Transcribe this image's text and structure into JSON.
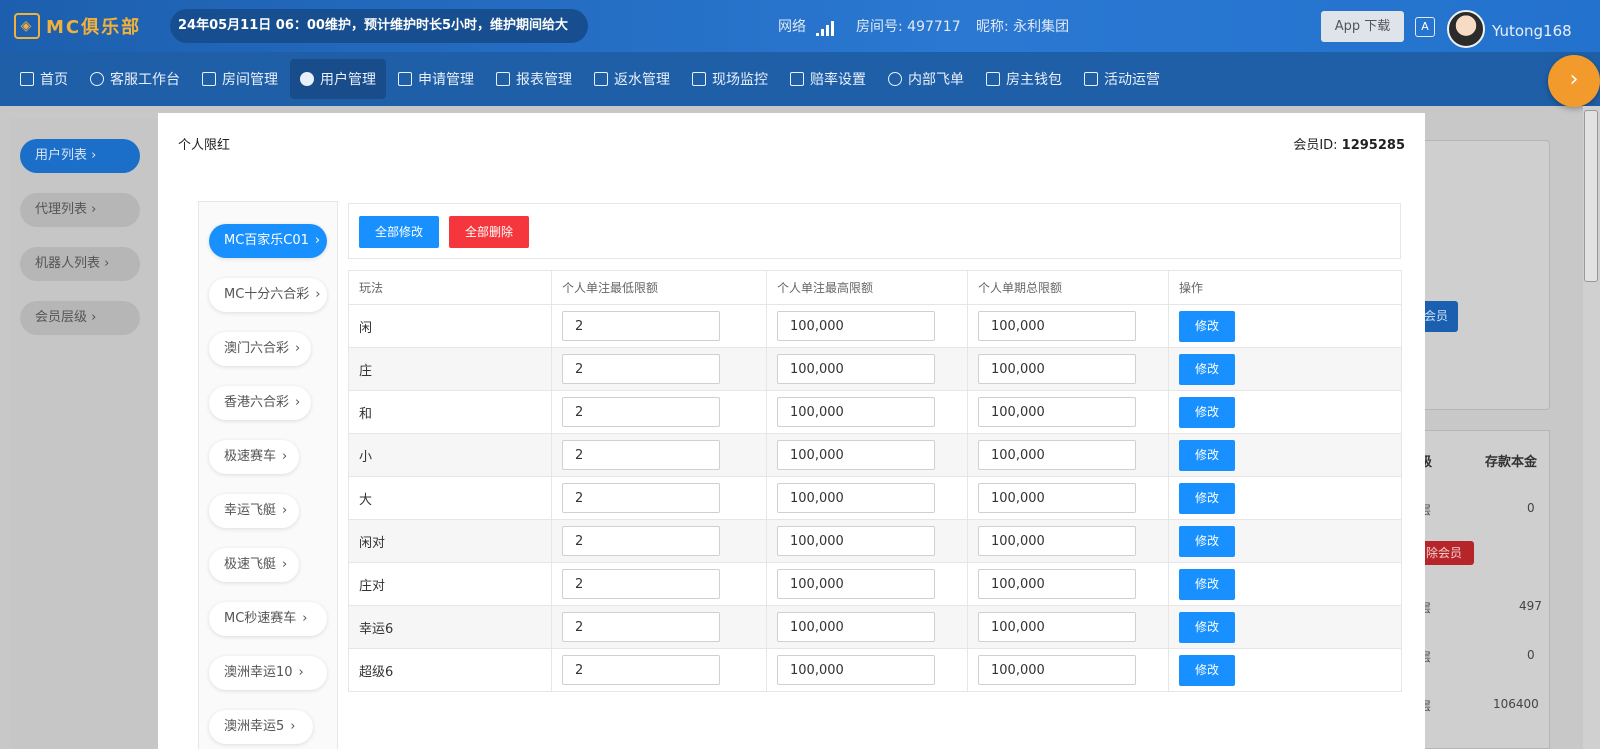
{
  "header": {
    "logo_text": "MC俱乐部",
    "notice": "24年05月11日 06：00维护，预计维护时长5小时，维护期间给大",
    "network_label": "网络",
    "room_label": "房间号: 497717",
    "nickname_label": "昵称: 永利集团",
    "app_download": "App 下载",
    "username": "Yutong168"
  },
  "nav": [
    {
      "label": "首页",
      "icon": "home-icon"
    },
    {
      "label": "客服工作台",
      "icon": "headset-icon"
    },
    {
      "label": "房间管理",
      "icon": "grid-icon"
    },
    {
      "label": "用户管理",
      "icon": "user-icon",
      "active": true
    },
    {
      "label": "申请管理",
      "icon": "document-icon"
    },
    {
      "label": "报表管理",
      "icon": "bar-chart-icon"
    },
    {
      "label": "返水管理",
      "icon": "tag-icon"
    },
    {
      "label": "现场监控",
      "icon": "monitor-icon"
    },
    {
      "label": "赔率设置",
      "icon": "shield-icon"
    },
    {
      "label": "内部飞单",
      "icon": "refresh-icon"
    },
    {
      "label": "房主钱包",
      "icon": "wallet-icon"
    },
    {
      "label": "活动运营",
      "icon": "gift-icon"
    }
  ],
  "sidebar": [
    {
      "label": "用户列表",
      "active": true
    },
    {
      "label": "代理列表"
    },
    {
      "label": "机器人列表"
    },
    {
      "label": "会员层级"
    }
  ],
  "background_page": {
    "add_member_fragment": "会员",
    "remove_member_fragment": "除会员",
    "col_level_fragment": "级",
    "col_deposit": "存款本金",
    "level_fragment": "层",
    "deposits": [
      "0",
      "497",
      "0",
      "106400"
    ]
  },
  "modal": {
    "title": "个人限红",
    "member_label": "会员ID: ",
    "member_id": "1295285",
    "tabs": [
      "MC百家乐C01",
      "MC十分六合彩",
      "澳门六合彩",
      "香港六合彩",
      "极速赛车",
      "幸运飞艇",
      "极速飞艇",
      "MC秒速赛车",
      "澳洲幸运10",
      "澳洲幸运5"
    ],
    "active_tab": 0,
    "edit_all": "全部修改",
    "delete_all": "全部删除",
    "columns": [
      "玩法",
      "个人单注最低限额",
      "个人单注最高限额",
      "个人单期总限额",
      "操作"
    ],
    "rows": [
      {
        "play": "闲",
        "min": "2",
        "max": "100,000",
        "total": "100,000"
      },
      {
        "play": "庄",
        "min": "2",
        "max": "100,000",
        "total": "100,000"
      },
      {
        "play": "和",
        "min": "2",
        "max": "100,000",
        "total": "100,000"
      },
      {
        "play": "小",
        "min": "2",
        "max": "100,000",
        "total": "100,000"
      },
      {
        "play": "大",
        "min": "2",
        "max": "100,000",
        "total": "100,000"
      },
      {
        "play": "闲对",
        "min": "2",
        "max": "100,000",
        "total": "100,000"
      },
      {
        "play": "庄对",
        "min": "2",
        "max": "100,000",
        "total": "100,000"
      },
      {
        "play": "幸运6",
        "min": "2",
        "max": "100,000",
        "total": "100,000"
      },
      {
        "play": "超级6",
        "min": "2",
        "max": "100,000",
        "total": "100,000"
      }
    ],
    "edit_label": "修改"
  }
}
